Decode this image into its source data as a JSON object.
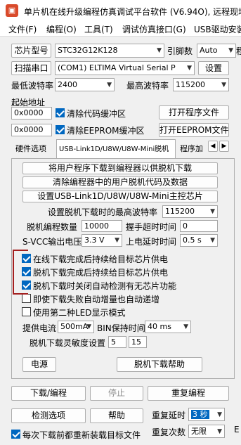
{
  "app": {
    "title": "单片机在线升级编程仿真调试平台软件 (V6.94O), 远程现场",
    "icon_name": "app-logo-icon"
  },
  "menu": [
    "文件(F)",
    "编程(O)",
    "工具(T)",
    "调试仿真接口(G)",
    "USB驱动安装"
  ],
  "top": {
    "chip_model_button": "芯片型号",
    "chip_model_value": "STC32G12K128",
    "pins_label": "引脚数",
    "pins_value": "Auto",
    "scan_port_button": "扫描串口",
    "port_value": "(COM1) ELTIMA Virtual Serial P",
    "settings_button": "设置",
    "min_baud_label": "最低波特率",
    "min_baud_value": "2400",
    "max_baud_label": "最高波特率",
    "max_baud_value": "115200",
    "start_addr_label": "起始地址",
    "code_addr": "0x0000",
    "clear_code_buffer": "清除代码缓冲区",
    "open_program_file": "打开程序文件",
    "eeprom_addr": "0x0000",
    "clear_eeprom_buffer": "清除EEPROM缓冲区",
    "open_eeprom_file": "打开EEPROM文件",
    "side_label": "程"
  },
  "tabs": [
    "硬件选项",
    "USB-Link1D/U8W/U8W-Mini脱机",
    "程序加"
  ],
  "offline": {
    "btn_download_user_program": "将用户程序下载到编程器以供脱机下载",
    "btn_clear_user_data": "清除编程器中的用户脱机代码及数据",
    "btn_set_master_chip": "设置USB-Link1D/U8W/U8W-Mini主控芯片",
    "max_baud_label": "设置脱机下载时的最高波特率",
    "max_baud_value": "115200",
    "count_label": "脱机编程数量",
    "count_value": "10000",
    "handshake_label": "握手超时时间",
    "handshake_value": "0",
    "svcc_label": "S-VCC输出电压",
    "svcc_value": "3.3 V",
    "power_delay_label": "上电延时时间",
    "power_delay_value": "0.5 s",
    "options": [
      {
        "label": "在线下载完成后持续给目标芯片供电",
        "checked": true
      },
      {
        "label": "脱机下载完成后持续给目标芯片供电",
        "checked": true
      },
      {
        "label": "脱机下载时关闭自动检测有无芯片功能",
        "checked": true
      },
      {
        "label": "即使下载失败自动增量也自动递增",
        "checked": false
      },
      {
        "label": "使用第二种LED显示模式",
        "checked": false
      }
    ],
    "supply_current_label": "提供电流",
    "supply_current_value": "500mA",
    "bin_hold_label": "BIN保持时间",
    "bin_hold_value": "40 ms",
    "sensitivity_label": "脱机下载灵敏度设置",
    "sens_a": "5",
    "sens_b": "15",
    "power_button": "电源",
    "help_button": "脱机下载帮助"
  },
  "bottom": {
    "download_button": "下载/编程",
    "stop_button": "停止",
    "reprogram_button": "重复编程",
    "check_options_button": "检测选项",
    "help_button": "帮助",
    "repeat_delay_label": "重复延时",
    "repeat_delay_value": "3 秒",
    "repeat_count_label": "重复次数",
    "repeat_count_value": "无限",
    "reload_label": "每次下载前都重新装载目标文件",
    "side_letter": "E"
  },
  "colors": {
    "highlight_box": "#a31f1f",
    "checkbox_on": "#0067c0"
  }
}
